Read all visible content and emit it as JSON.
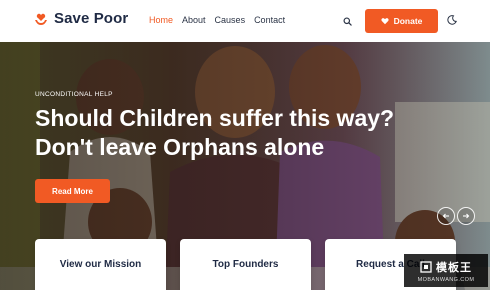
{
  "brand": {
    "name": "Save Poor",
    "logo_icon": "hands-heart-icon"
  },
  "nav": {
    "items": [
      {
        "label": "Home",
        "active": true
      },
      {
        "label": "About",
        "active": false
      },
      {
        "label": "Causes",
        "active": false
      },
      {
        "label": "Contact",
        "active": false
      }
    ]
  },
  "header": {
    "search_icon": "search-icon",
    "donate_label": "Donate",
    "donate_icon": "heart-icon",
    "theme_icon": "moon-icon"
  },
  "hero": {
    "eyebrow": "UNCONDITIONAL HELP",
    "headline_line1": "Should Children suffer this way?",
    "headline_line2": "Don't leave Orphans alone",
    "cta_label": "Read More",
    "prev_icon": "arrow-left-icon",
    "next_icon": "arrow-right-icon"
  },
  "cards": [
    {
      "label": "View our Mission"
    },
    {
      "label": "Top Founders"
    },
    {
      "label": "Request a Call"
    }
  ],
  "watermark": {
    "title": "模板王",
    "subtitle": "MOBANWANG.COM"
  },
  "colors": {
    "accent": "#f15a24",
    "text_dark": "#1f2a44",
    "white": "#ffffff"
  }
}
